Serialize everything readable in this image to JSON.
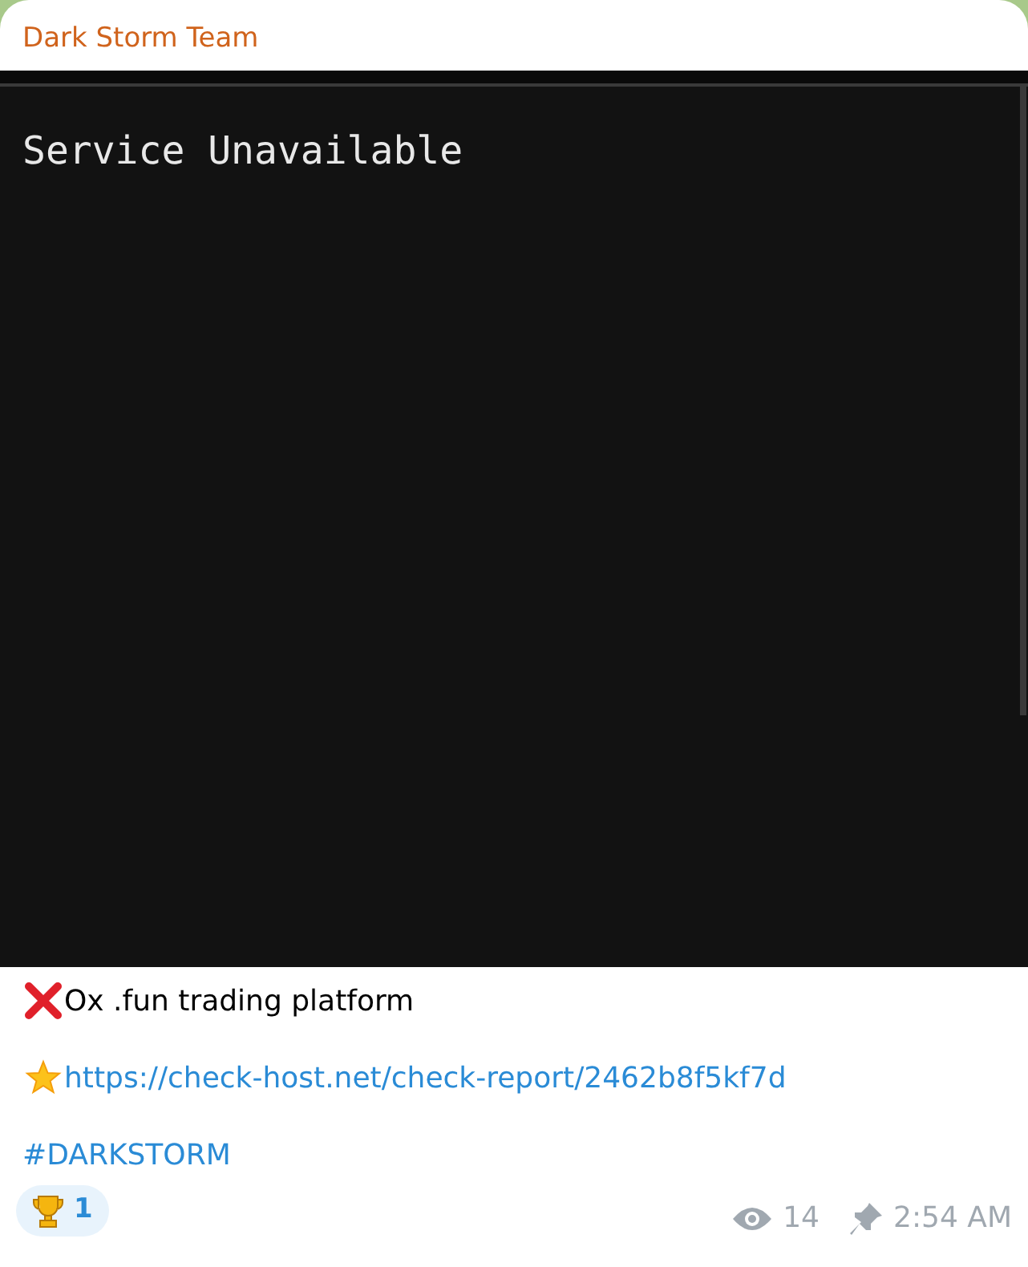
{
  "message": {
    "sender": "Dark Storm Team",
    "screenshot": {
      "text": "Service Unavailable"
    },
    "lines": [
      {
        "kind": "status",
        "text": "Ox .fun trading platform"
      },
      {
        "kind": "link",
        "text": "https://check-host.net/check-report/2462b8f5kf7d"
      },
      {
        "kind": "hashtag",
        "text": "#DARKSTORM"
      }
    ],
    "reaction": {
      "count": "1",
      "selected": false
    },
    "views": "14",
    "time": "2:54 AM",
    "pinned": true
  }
}
